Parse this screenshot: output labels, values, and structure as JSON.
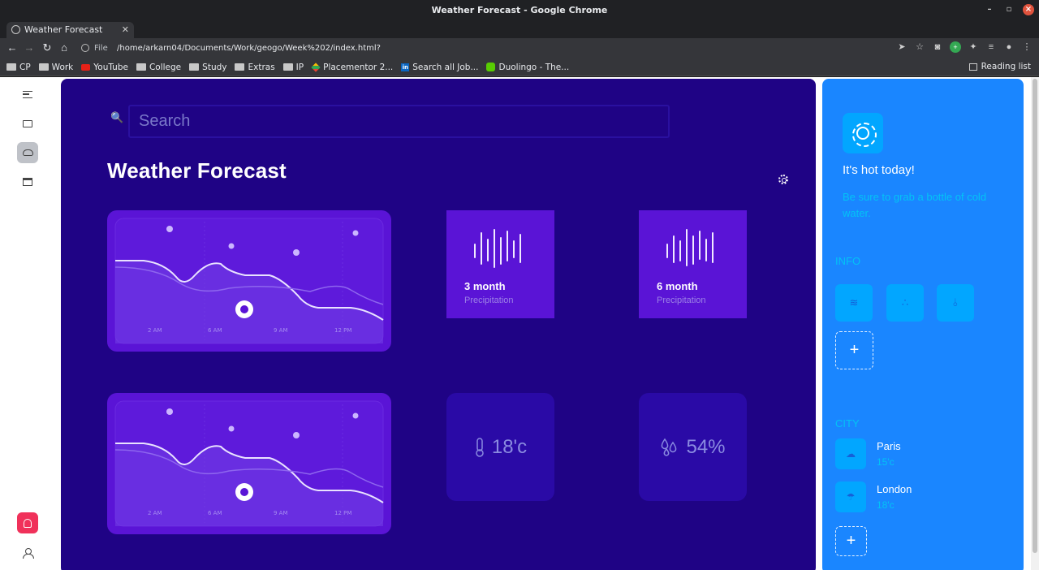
{
  "window": {
    "title": "Weather Forecast - Google Chrome"
  },
  "tab": {
    "label": "Weather Forecast"
  },
  "omnibox": {
    "scheme": "File",
    "url": "/home/arkarn04/Documents/Work/geogo/Week%202/index.html?"
  },
  "bookmarks": [
    {
      "label": "CP",
      "icon": "folder-icon"
    },
    {
      "label": "Work",
      "icon": "folder-icon"
    },
    {
      "label": "YouTube",
      "icon": "youtube-icon"
    },
    {
      "label": "College",
      "icon": "folder-icon"
    },
    {
      "label": "Study",
      "icon": "folder-icon"
    },
    {
      "label": "Extras",
      "icon": "folder-icon"
    },
    {
      "label": "IP",
      "icon": "folder-icon"
    },
    {
      "label": "Placementor 2...",
      "icon": "placementor-icon"
    },
    {
      "label": "Search all Job...",
      "icon": "linkedin-icon"
    },
    {
      "label": "Duolingo - The...",
      "icon": "duolingo-icon"
    }
  ],
  "reading_list": "Reading list",
  "search": {
    "placeholder": "Search"
  },
  "page_title": "Weather Forecast",
  "graph_labels": [
    "2 AM",
    "6 AM",
    "9 AM",
    "12 PM"
  ],
  "precip": [
    {
      "title": "3 month",
      "subtitle": "Precipitation"
    },
    {
      "title": "6 month",
      "subtitle": "Precipitation"
    }
  ],
  "stats": {
    "temperature": "18'c",
    "humidity": "54%"
  },
  "side": {
    "headline": "It's hot today!",
    "subtext": "Be sure to grab a bottle of cold water.",
    "info_label": "INFO",
    "city_label": "CITY",
    "add": "+",
    "cities": [
      {
        "name": "Paris",
        "temp": "15'c"
      },
      {
        "name": "London",
        "temp": "18'c"
      }
    ]
  },
  "colors": {
    "main_bg": "#1f0385",
    "side_bg": "#1a86ff",
    "accent_cyan": "#03c3f5",
    "card_purple": "#5a14d6",
    "bell_red": "#f0315a"
  }
}
